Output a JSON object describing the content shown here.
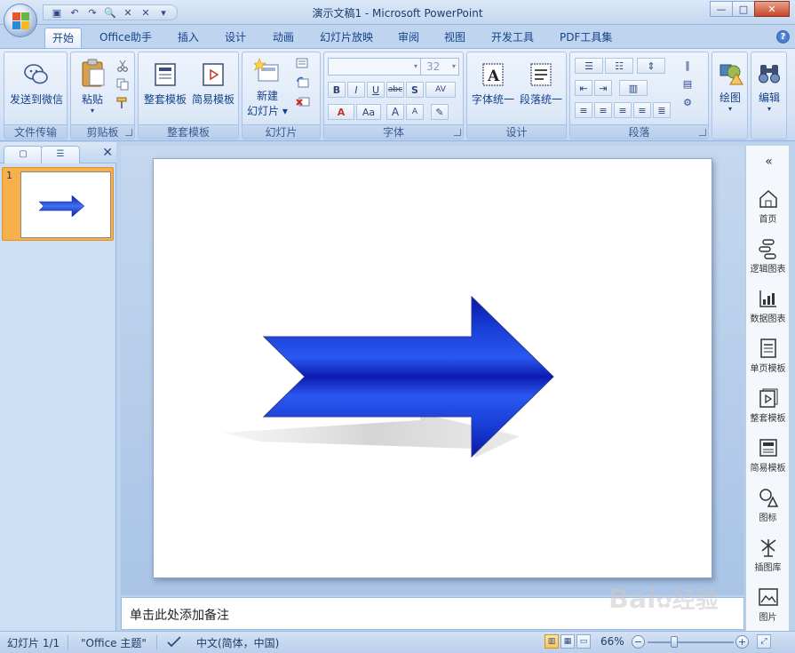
{
  "window": {
    "title": "演示文稿1 - Microsoft PowerPoint",
    "controls": {
      "minimize": "—",
      "maximize": "□",
      "close": "✕"
    }
  },
  "quick_access": {
    "items": [
      "save-icon",
      "undo-icon",
      "redo-icon",
      "print-preview-icon",
      "x-icon",
      "x-icon",
      "dropdown-icon"
    ],
    "glyphs": [
      "▣",
      "↶",
      "↷",
      "🔍",
      "✕",
      "✕",
      "▾"
    ]
  },
  "tabs": [
    {
      "label": "开始",
      "active": true
    },
    {
      "label": "Office助手"
    },
    {
      "label": "插入"
    },
    {
      "label": "设计"
    },
    {
      "label": "动画"
    },
    {
      "label": "幻灯片放映"
    },
    {
      "label": "审阅"
    },
    {
      "label": "视图"
    },
    {
      "label": "开发工具"
    },
    {
      "label": "PDF工具集"
    }
  ],
  "help": {
    "glyph": "?"
  },
  "ribbon": {
    "groups": {
      "file_transfer": {
        "label": "文件传输",
        "send_wechat": "发送到微信"
      },
      "clipboard": {
        "label": "剪贴板",
        "paste": "粘贴",
        "paste_arrow": "▾"
      },
      "template": {
        "label": "整套模板",
        "full_template": "整套模板",
        "simple_template": "简易模板"
      },
      "slides": {
        "label": "幻灯片",
        "new_slide_line1": "新建",
        "new_slide_line2": "幻灯片 ▾"
      },
      "font": {
        "label": "字体",
        "font_size": "32",
        "bold": "B",
        "italic": "I",
        "underline": "U",
        "strike": "abc",
        "shadow": "S",
        "spacing": "AV",
        "font_color": "A",
        "change_case": "Aa",
        "grow": "A",
        "shrink": "A",
        "clear": "✎"
      },
      "design": {
        "label": "设计",
        "font_unify": "字体统一",
        "para_unify": "段落统一"
      },
      "paragraph": {
        "label": "段落"
      },
      "drawing": {
        "draw": "绘图",
        "edit": "编辑",
        "arrow": "▾"
      }
    }
  },
  "left_pane": {
    "slide_number": "1",
    "close_glyph": "✕"
  },
  "notes": {
    "placeholder": "单击此处添加备注"
  },
  "right_bar": {
    "collapse": "«",
    "items": [
      {
        "label": "首页",
        "icon": "home-icon"
      },
      {
        "label": "逻辑图表",
        "icon": "logic-chart-icon"
      },
      {
        "label": "数据图表",
        "icon": "data-chart-icon"
      },
      {
        "label": "单页模板",
        "icon": "single-page-template-icon"
      },
      {
        "label": "整套模板",
        "icon": "full-template-icon"
      },
      {
        "label": "简易模板",
        "icon": "simple-template-icon"
      },
      {
        "label": "图标",
        "icon": "shapes-icon"
      },
      {
        "label": "插图库",
        "icon": "illustration-icon"
      },
      {
        "label": "图片",
        "icon": "picture-icon"
      }
    ]
  },
  "status": {
    "slide_info": "幻灯片 1/1",
    "theme": "\"Office 主题\"",
    "language": "中文(简体，中国)",
    "zoom": "66%"
  },
  "colors": {
    "arrow_dark": "#0a1fb0",
    "arrow_light": "#3a6cf0",
    "ribbon_text": "#15428b",
    "selected_thumb": "#f7b04a"
  },
  "watermark": {
    "text": "Bai",
    "text2": "经验"
  }
}
